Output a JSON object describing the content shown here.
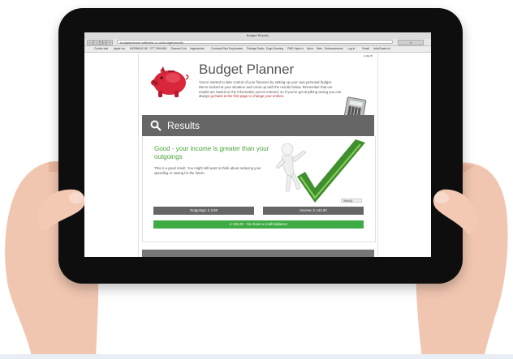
{
  "browser": {
    "window_title": "Budget Results",
    "url": "budgetplanner.artfiselle.co.uk/budget/results",
    "bookmarks": [
      "Cookie stat",
      "Apple Inc.",
      "MORNING NE",
      "OTT SHINING",
      "Channel 5 uk",
      "Ingentorials",
      "Constant Red",
      "Emplorates",
      "Pubdge Radio",
      "Dogs Sensing",
      "PMS Hydro's",
      "Arbor",
      "Web",
      "Enhancements",
      "Log In",
      "Gmail",
      "ArtieGrade uk"
    ]
  },
  "page": {
    "login_link": "Log in",
    "heading": "Budget Planner",
    "intro_text": "You've started to take control of your finances by setting up your own personal budget. We've looked at your situation and come up with the results below. Remember that our results are based on the information you've entered, so if you've got anything wrong you can always",
    "intro_link": "go back to the first page to change your entries.",
    "results_title": "Results",
    "result_heading": "Good - your income is greater than your outgoings",
    "result_desc": "This is a good result. You might still want to think about reducing your spending or saving for the future.",
    "view_by": "Weekly",
    "outgoings_label": "Outgoings: £ 2.80",
    "income_label": "Income: £ 142.00",
    "credit_label": "£ 139.20 - You have a credit balance!"
  },
  "colors": {
    "accent_green": "#3fab44",
    "heading_green": "#4aa33a",
    "bar_gray": "#666666",
    "piggy_red": "#d8263a",
    "link_red": "#b0232a"
  }
}
